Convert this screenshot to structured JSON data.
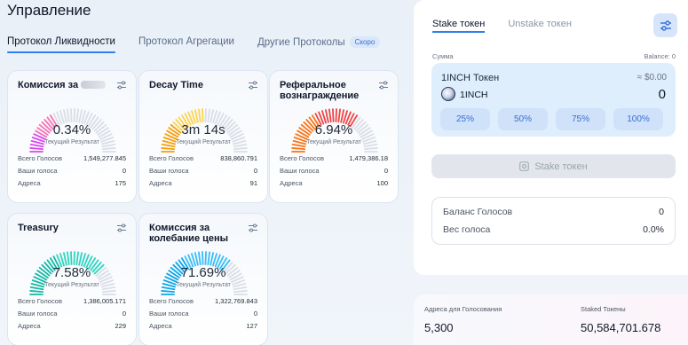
{
  "header": {
    "title": "Управление",
    "tabs": [
      {
        "label": "Протокол Ликвидности",
        "active": true
      },
      {
        "label": "Протокол Агрегации",
        "active": false
      },
      {
        "label": "Другие Протоколы",
        "active": false,
        "badge": "Скоро"
      }
    ]
  },
  "cards": [
    {
      "title": "Комиссия за",
      "value": "0.34%",
      "fraction": 0.34,
      "caption": "Текущий Результат",
      "colors": [
        "#d946ef",
        "#f472b6"
      ],
      "stats": [
        {
          "label": "Всего Голосов",
          "value": "1,549,277.845"
        },
        {
          "label": "Ваши голоса",
          "value": "0"
        },
        {
          "label": "Адреса",
          "value": "175"
        }
      ]
    },
    {
      "title": "Decay Time",
      "value": "3m 14s",
      "fraction": 0.5,
      "caption": "Текущий Результат",
      "colors": [
        "#f59e0b",
        "#fcd34d"
      ],
      "stats": [
        {
          "label": "Всего Голосов",
          "value": "838,860.791"
        },
        {
          "label": "Ваши голоса",
          "value": "0"
        },
        {
          "label": "Адреса",
          "value": "91"
        }
      ]
    },
    {
      "title": "Реферальное вознаграждение",
      "value": "6.94%",
      "fraction": 0.69,
      "caption": "Текущий Результат",
      "colors": [
        "#f97316",
        "#ef4444"
      ],
      "stats": [
        {
          "label": "Всего Голосов",
          "value": "1,479,386.18"
        },
        {
          "label": "Ваши голоса",
          "value": "0"
        },
        {
          "label": "Адреса",
          "value": "100"
        }
      ]
    },
    {
      "title": "Treasury",
      "value": "7.58%",
      "fraction": 0.76,
      "caption": "Текущий Результат",
      "colors": [
        "#14b8a6",
        "#2dd4bf"
      ],
      "stats": [
        {
          "label": "Всего Голосов",
          "value": "1,386,005.171"
        },
        {
          "label": "Ваши голоса",
          "value": "0"
        },
        {
          "label": "Адреса",
          "value": "229"
        }
      ]
    },
    {
      "title": "Комиссия за колебание цены",
      "value": "71.69%",
      "fraction": 0.72,
      "caption": "Текущий Результат",
      "colors": [
        "#0ea5e9",
        "#38bdf8"
      ],
      "stats": [
        {
          "label": "Всего Голосов",
          "value": "1,322,769.843"
        },
        {
          "label": "Ваши голоса",
          "value": "0"
        },
        {
          "label": "Адреса",
          "value": "127"
        }
      ]
    }
  ],
  "stake_panel": {
    "tabs": [
      {
        "label": "Stake токен",
        "active": true
      },
      {
        "label": "Unstake токен",
        "active": false
      }
    ],
    "amount_label": "Сумма",
    "balance_label": "Balance: 0",
    "token_name": "1INCH Токен",
    "token_usd": "≈ $0.00",
    "token_symbol": "1INCH",
    "amount_value": "0",
    "percents": [
      "25%",
      "50%",
      "75%",
      "100%"
    ],
    "stake_button": "Stake токен",
    "vote_balance_label": "Баланс Голосов",
    "vote_balance_value": "0",
    "vote_weight_label": "Вес голоса",
    "vote_weight_value": "0.0%"
  },
  "bottom_stats": {
    "voting_addresses_label": "Адреса для Голосования",
    "voting_addresses_value": "5,300",
    "staked_tokens_label": "Staked Токены",
    "staked_tokens_value": "50,584,701.678"
  }
}
